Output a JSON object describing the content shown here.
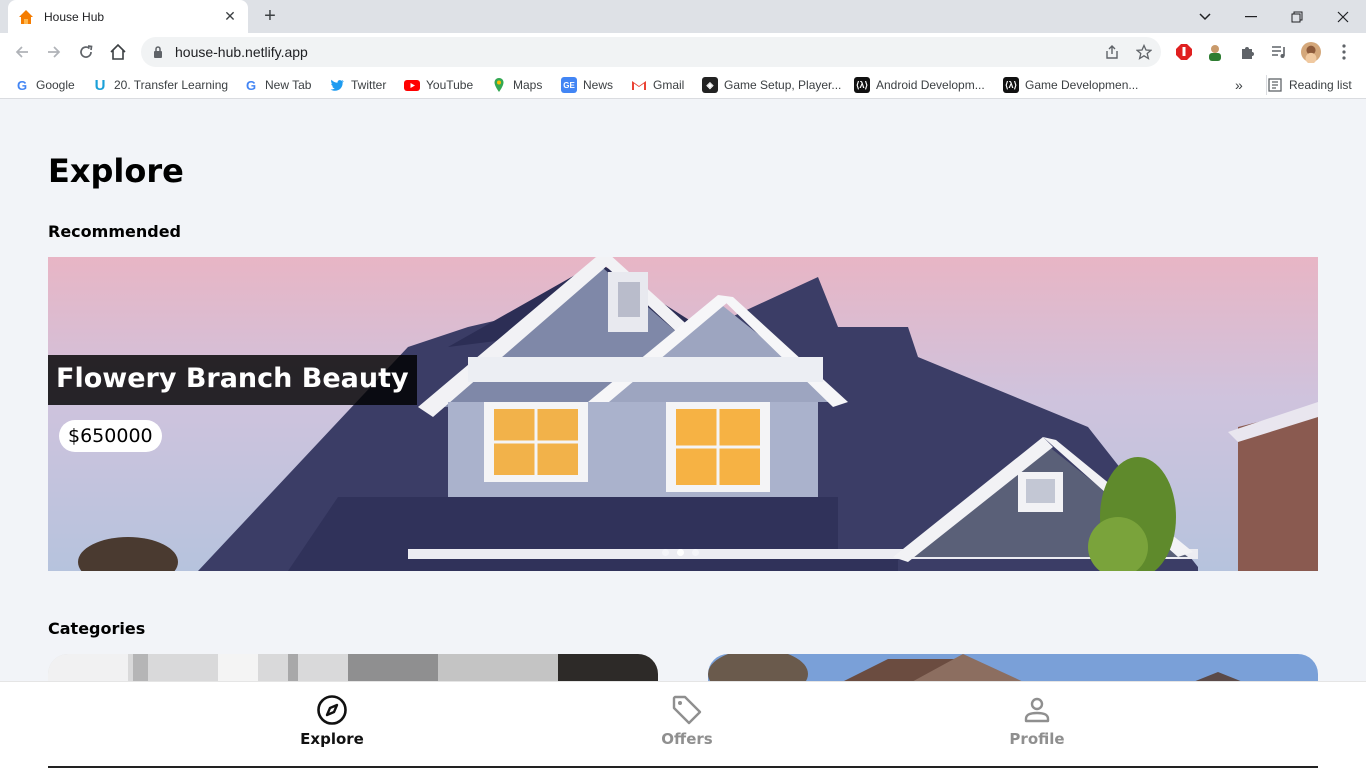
{
  "browser": {
    "tab_title": "House Hub",
    "url": "house-hub.netlify.app",
    "bookmarks": [
      {
        "label": "Google",
        "icon": "google-icon"
      },
      {
        "label": "20. Transfer Learning",
        "icon": "udemy-icon"
      },
      {
        "label": "New Tab",
        "icon": "google-icon"
      },
      {
        "label": "Twitter",
        "icon": "twitter-icon"
      },
      {
        "label": "YouTube",
        "icon": "youtube-icon"
      },
      {
        "label": "Maps",
        "icon": "maps-icon"
      },
      {
        "label": "News",
        "icon": "news-icon"
      },
      {
        "label": "Gmail",
        "icon": "gmail-icon"
      },
      {
        "label": "Game Setup, Player...",
        "icon": "unity-icon"
      },
      {
        "label": "Android Developm...",
        "icon": "android-dev-icon"
      },
      {
        "label": "Game Developmen...",
        "icon": "game-dev-icon"
      }
    ],
    "reading_list": "Reading list"
  },
  "page": {
    "title": "Explore",
    "recommended_heading": "Recommended",
    "hero": {
      "name": "Flowery Branch Beauty",
      "price": "$650000",
      "slide_count": 3,
      "active_slide": 2
    },
    "categories_heading": "Categories"
  },
  "bottom_nav": [
    {
      "label": "Explore",
      "icon": "compass-icon",
      "active": true
    },
    {
      "label": "Offers",
      "icon": "tag-icon",
      "active": false
    },
    {
      "label": "Profile",
      "icon": "person-icon",
      "active": false
    }
  ],
  "colors": {
    "active_nav": "#111111",
    "inactive_nav": "#8f8f8f",
    "background": "#f2f4f8"
  }
}
